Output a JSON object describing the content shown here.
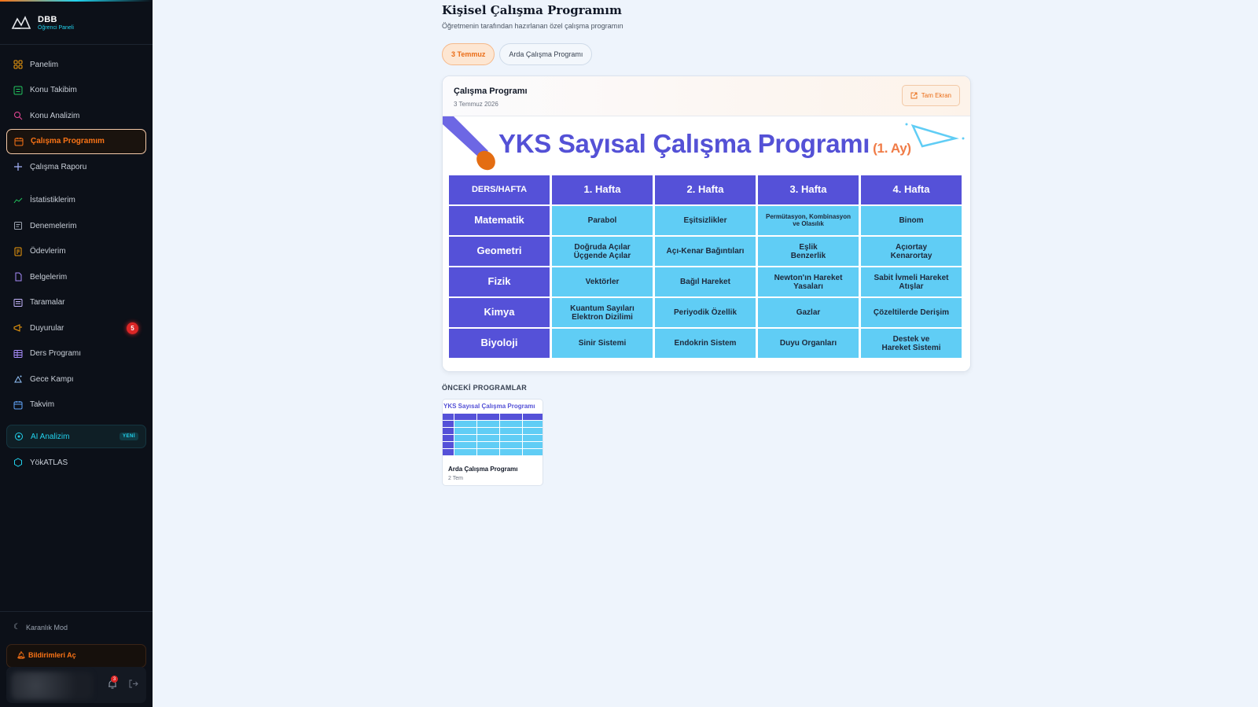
{
  "brand": {
    "title": "DBB",
    "subtitle": "Öğrenci Paneli"
  },
  "sidebar": {
    "items": [
      {
        "label": "Panelim",
        "icon": "grid-icon"
      },
      {
        "label": "Konu Takibim",
        "icon": "checklist-icon"
      },
      {
        "label": "Konu Analizim",
        "icon": "search-icon"
      },
      {
        "label": "Çalışma Programım",
        "icon": "calendar-icon",
        "active": true
      },
      {
        "label": "Çalışma Raporu",
        "icon": "plus-icon"
      },
      {
        "label": "İstatistiklerim",
        "icon": "trend-icon"
      },
      {
        "label": "Denemelerim",
        "icon": "doc-icon"
      },
      {
        "label": "Ödevlerim",
        "icon": "notes-icon"
      },
      {
        "label": "Belgelerim",
        "icon": "file-icon"
      },
      {
        "label": "Taramalar",
        "icon": "scan-icon"
      },
      {
        "label": "Duyurular",
        "icon": "megaphone-icon",
        "badge": "5"
      },
      {
        "label": "Ders Programı",
        "icon": "table-icon"
      },
      {
        "label": "Gece Kampı",
        "icon": "night-icon"
      },
      {
        "label": "Takvim",
        "icon": "calendar-icon"
      }
    ],
    "ai": {
      "label": "AI Analizim",
      "badge": "YENİ"
    },
    "yok": {
      "label": "YökATLAS"
    },
    "dark_mode": "Karanlık Mod",
    "notif_button": "Bildirimleri Aç",
    "bell_count": "3"
  },
  "page": {
    "title": "Kişisel Çalışma Programım",
    "subtitle": "Öğretmenin tarafından hazırlanan özel çalışma programın",
    "tabs": [
      "3 Temmuz",
      "Arda Çalışma Programı"
    ]
  },
  "card": {
    "title": "Çalışma Programı",
    "date": "3 Temmuz 2026",
    "fullscreen": "Tam Ekran"
  },
  "program": {
    "title": "YKS Sayısal Çalışma Programı",
    "title_suffix": "(1. Ay)",
    "header": [
      "DERS/HAFTA",
      "1. Hafta",
      "2. Hafta",
      "3. Hafta",
      "4. Hafta"
    ],
    "rows": [
      {
        "subject": "Matematik",
        "topics": [
          "Parabol",
          "Eşitsizlikler",
          "Permütasyon, Kombinasyon\nve Olasılık",
          "Binom"
        ]
      },
      {
        "subject": "Geometri",
        "topics": [
          "Doğruda Açılar\nÜçgende Açılar",
          "Açı-Kenar Bağıntıları",
          "Eşlik\nBenzerlik",
          "Açıortay\nKenarortay"
        ]
      },
      {
        "subject": "Fizik",
        "topics": [
          "Vektörler",
          "Bağıl Hareket",
          "Newton'ın Hareket\nYasaları",
          "Sabit İvmeli Hareket\nAtışlar"
        ]
      },
      {
        "subject": "Kimya",
        "topics": [
          "Kuantum Sayıları\nElektron Dizilimi",
          "Periyodik Özellik",
          "Gazlar",
          "Çözeltilerde Derişim"
        ]
      },
      {
        "subject": "Biyoloji",
        "topics": [
          "Sinir Sistemi",
          "Endokrin Sistem",
          "Duyu Organları",
          "Destek ve\nHareket Sistemi"
        ]
      }
    ]
  },
  "previous": {
    "label": "ÖNCEKİ PROGRAMLAR",
    "items": [
      {
        "name": "Arda Çalışma Programı",
        "date": "2 Tem",
        "thumb_title": "YKS Sayısal Çalışma Programı"
      }
    ]
  },
  "colors": {
    "accent": "#f97316",
    "program_blue": "#5551d8",
    "topic_cyan": "#60cdf5",
    "sidebar_bg": "#0c1018"
  }
}
